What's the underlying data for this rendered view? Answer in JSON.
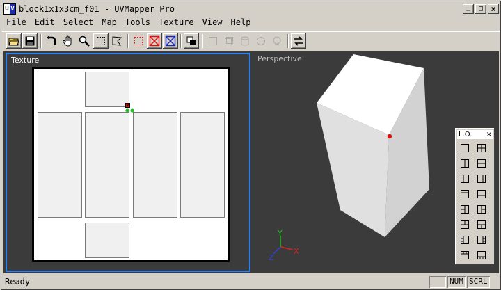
{
  "app": {
    "icon_letters": [
      "U",
      "V"
    ],
    "title": "block1x1x3cm_f01 - UVMapper Pro"
  },
  "window_buttons": {
    "minimize": "_",
    "maximize": "□",
    "close": "×"
  },
  "menu": [
    {
      "pre": "",
      "u": "F",
      "post": "ile"
    },
    {
      "pre": "",
      "u": "E",
      "post": "dit"
    },
    {
      "pre": "",
      "u": "S",
      "post": "elect"
    },
    {
      "pre": "",
      "u": "M",
      "post": "ap"
    },
    {
      "pre": "",
      "u": "T",
      "post": "ools"
    },
    {
      "pre": "Te",
      "u": "x",
      "post": "ture"
    },
    {
      "pre": "",
      "u": "V",
      "post": "iew"
    },
    {
      "pre": "",
      "u": "H",
      "post": "elp"
    }
  ],
  "toolbar": {
    "icons": [
      "open-folder-icon",
      "save-icon",
      "undo-icon",
      "hand-icon",
      "zoom-icon",
      "marquee-select-icon",
      "lasso-icon",
      "select-points-icon",
      "select-none-icon",
      "select-all-icon",
      "copy-icon",
      "cube-icon",
      "box-icon",
      "cylinder-icon",
      "sphere-icon",
      "head-icon",
      "swap-icon"
    ]
  },
  "viewports": {
    "texture_label": "Texture",
    "perspective_label": "Perspective"
  },
  "axes": {
    "x": "X",
    "y": "Y",
    "z": "Z"
  },
  "lo_palette": {
    "title": "L.O.",
    "close": "×"
  },
  "status": {
    "text": "Ready",
    "num": "NUM",
    "scrl": "SCRL"
  },
  "colors": {
    "viewport_bg": "#3b3b3b",
    "active_border": "#2c7ff0",
    "selection_red": "#e01010",
    "selection_green": "#20c020",
    "axis_x": "#e02020",
    "axis_y": "#20c020",
    "axis_z": "#3040e0"
  }
}
